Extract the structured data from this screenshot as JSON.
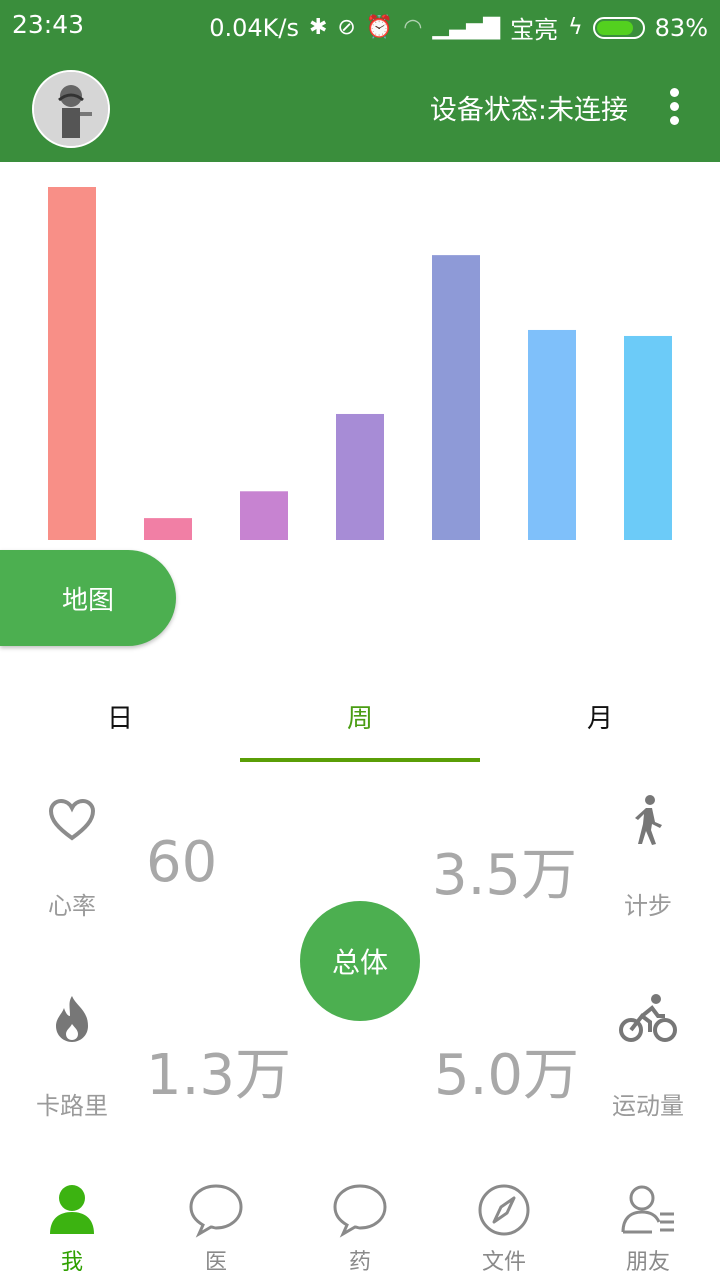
{
  "status": {
    "time": "23:43",
    "speed": "0.04K/s",
    "carrier": "宝亮",
    "battery": "83%",
    "battery_level": 0.83
  },
  "header": {
    "device_status": "设备状态:未连接"
  },
  "chart_data": {
    "type": "bar",
    "values": [
      100,
      6.2,
      13.8,
      35.7,
      80.7,
      59.5,
      57.8
    ],
    "ylim": [
      0,
      100
    ],
    "colors": [
      "#f88f87",
      "#f17fa5",
      "#c783d1",
      "#a78cd6",
      "#8e9ad7",
      "#7fc0fa",
      "#6ccbf8"
    ],
    "grid": false
  },
  "map_button": "地图",
  "tabs": [
    {
      "label": "日",
      "active": false
    },
    {
      "label": "周",
      "active": true
    },
    {
      "label": "月",
      "active": false
    }
  ],
  "stats": {
    "heart_rate": {
      "label": "心率",
      "value": "60",
      "icon": "heart-icon"
    },
    "steps": {
      "label": "计步",
      "value": "3.5万",
      "icon": "walking-icon"
    },
    "calories": {
      "label": "卡路里",
      "value": "1.3万",
      "icon": "flame-icon"
    },
    "activity": {
      "label": "运动量",
      "value": "5.0万",
      "icon": "bicycle-icon"
    }
  },
  "center_button": "总体",
  "nav": [
    {
      "label": "我",
      "icon": "person-icon",
      "active": true
    },
    {
      "label": "医",
      "icon": "chat-bubble-icon",
      "active": false
    },
    {
      "label": "药",
      "icon": "chat-bubble-icon",
      "active": false
    },
    {
      "label": "文件",
      "icon": "compass-icon",
      "active": false
    },
    {
      "label": "朋友",
      "icon": "contacts-icon",
      "active": false
    }
  ]
}
